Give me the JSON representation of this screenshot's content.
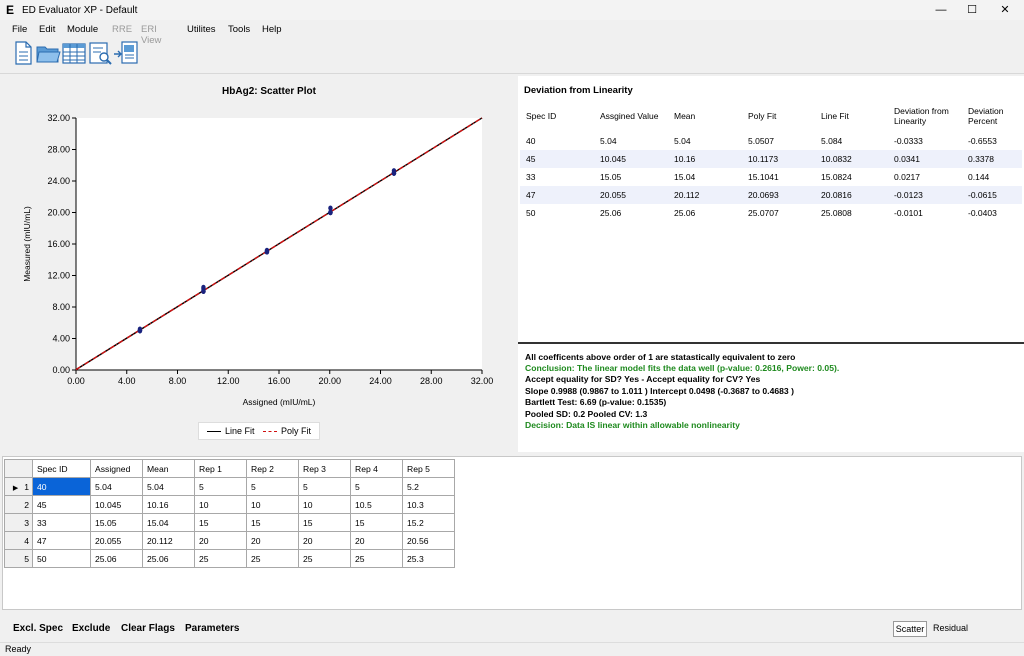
{
  "window": {
    "title": "ED Evaluator XP - Default",
    "app_icon": "E"
  },
  "menu": [
    "File",
    "Edit",
    "Module",
    "RRE",
    "ERI View",
    "Utilites",
    "Tools",
    "Help"
  ],
  "toolbar": [
    "new-document-icon",
    "open-folder-icon",
    "table-icon",
    "report-icon",
    "export-icon"
  ],
  "chart": {
    "title": "HbAg2: Scatter Plot",
    "legend": {
      "line_fit": "Line Fit",
      "poly_fit": "Poly Fit"
    },
    "colors": {
      "line_fit": "#000000",
      "poly_fit": "#d01010",
      "points": "#1a237e"
    }
  },
  "chart_data": {
    "type": "scatter",
    "title": "HbAg2: Scatter Plot",
    "xlabel": "Assigned (mIU/mL)",
    "ylabel": "Measured (mIU/mL)",
    "xlim": [
      0,
      32
    ],
    "ylim": [
      0,
      32
    ],
    "x_ticks": [
      "0.00",
      "4.00",
      "8.00",
      "12.00",
      "16.00",
      "20.00",
      "24.00",
      "28.00",
      "32.00"
    ],
    "y_ticks": [
      "0.00",
      "4.00",
      "8.00",
      "12.00",
      "16.00",
      "20.00",
      "24.00",
      "28.00",
      "32.00"
    ],
    "points": [
      {
        "x": 5.04,
        "y": 5
      },
      {
        "x": 5.04,
        "y": 5
      },
      {
        "x": 5.04,
        "y": 5
      },
      {
        "x": 5.04,
        "y": 5
      },
      {
        "x": 5.04,
        "y": 5.2
      },
      {
        "x": 10.045,
        "y": 10
      },
      {
        "x": 10.045,
        "y": 10
      },
      {
        "x": 10.045,
        "y": 10
      },
      {
        "x": 10.045,
        "y": 10.5
      },
      {
        "x": 10.045,
        "y": 10.3
      },
      {
        "x": 15.05,
        "y": 15
      },
      {
        "x": 15.05,
        "y": 15
      },
      {
        "x": 15.05,
        "y": 15
      },
      {
        "x": 15.05,
        "y": 15
      },
      {
        "x": 15.05,
        "y": 15.2
      },
      {
        "x": 20.055,
        "y": 20
      },
      {
        "x": 20.055,
        "y": 20
      },
      {
        "x": 20.055,
        "y": 20
      },
      {
        "x": 20.055,
        "y": 20
      },
      {
        "x": 20.055,
        "y": 20.56
      },
      {
        "x": 25.06,
        "y": 25
      },
      {
        "x": 25.06,
        "y": 25
      },
      {
        "x": 25.06,
        "y": 25
      },
      {
        "x": 25.06,
        "y": 25
      },
      {
        "x": 25.06,
        "y": 25.3
      }
    ],
    "series": [
      {
        "name": "Line Fit",
        "slope": 0.9988,
        "intercept": 0.0498
      },
      {
        "name": "Poly Fit"
      }
    ],
    "legend_position": "bottom-center",
    "grid": false
  },
  "deviation": {
    "title": "Deviation from Linearity",
    "headers": [
      "Spec ID",
      "Assgined Value",
      "Mean",
      "Poly Fit",
      "Line Fit",
      "Deviation from Linearity",
      "Deviation Percent"
    ],
    "rows": [
      [
        "40",
        "5.04",
        "5.04",
        "5.0507",
        "5.084",
        "-0.0333",
        "-0.6553"
      ],
      [
        "45",
        "10.045",
        "10.16",
        "10.1173",
        "10.0832",
        "0.0341",
        "0.3378"
      ],
      [
        "33",
        "15.05",
        "15.04",
        "15.1041",
        "15.0824",
        "0.0217",
        "0.144"
      ],
      [
        "47",
        "20.055",
        "20.112",
        "20.0693",
        "20.0816",
        "-0.0123",
        "-0.0615"
      ],
      [
        "50",
        "25.06",
        "25.06",
        "25.0707",
        "25.0808",
        "-0.0101",
        "-0.0403"
      ]
    ]
  },
  "conclusion": {
    "line1": "All coefficents above order of 1 are statastically equivalent to zero",
    "line2": "Conclusion: The linear model fits the data well (p-value: 0.2616, Power: 0.05).",
    "line3": "Accept equality for SD? Yes - Accept equality for CV? Yes",
    "line4": "Slope 0.9988 (0.9867 to 1.011 ) Intercept 0.0498 (-0.3687 to 0.4683 )",
    "line5": "Bartlett Test: 6.69 (p-value: 0.1535)",
    "line6": "Pooled SD: 0.2 Pooled CV: 1.3",
    "line7": "Decision: Data IS linear within allowable nonlinearity"
  },
  "grid": {
    "headers": [
      "Spec ID",
      "Assigned",
      "Mean",
      "Rep 1",
      "Rep 2",
      "Rep 3",
      "Rep 4",
      "Rep 5"
    ],
    "rows": [
      {
        "num": "1",
        "cells": [
          "40",
          "5.04",
          "5.04",
          "5",
          "5",
          "5",
          "5",
          "5.2"
        ]
      },
      {
        "num": "2",
        "cells": [
          "45",
          "10.045",
          "10.16",
          "10",
          "10",
          "10",
          "10.5",
          "10.3"
        ]
      },
      {
        "num": "3",
        "cells": [
          "33",
          "15.05",
          "15.04",
          "15",
          "15",
          "15",
          "15",
          "15.2"
        ]
      },
      {
        "num": "4",
        "cells": [
          "47",
          "20.055",
          "20.112",
          "20",
          "20",
          "20",
          "20",
          "20.56"
        ]
      },
      {
        "num": "5",
        "cells": [
          "50",
          "25.06",
          "25.06",
          "25",
          "25",
          "25",
          "25",
          "25.3"
        ]
      }
    ]
  },
  "bottom": {
    "excl_spec": "Excl. Spec",
    "exclude": "Exclude",
    "clear_flags": "Clear Flags",
    "parameters": "Parameters",
    "scatter": "Scatter",
    "residual": "Residual"
  },
  "status": "Ready"
}
